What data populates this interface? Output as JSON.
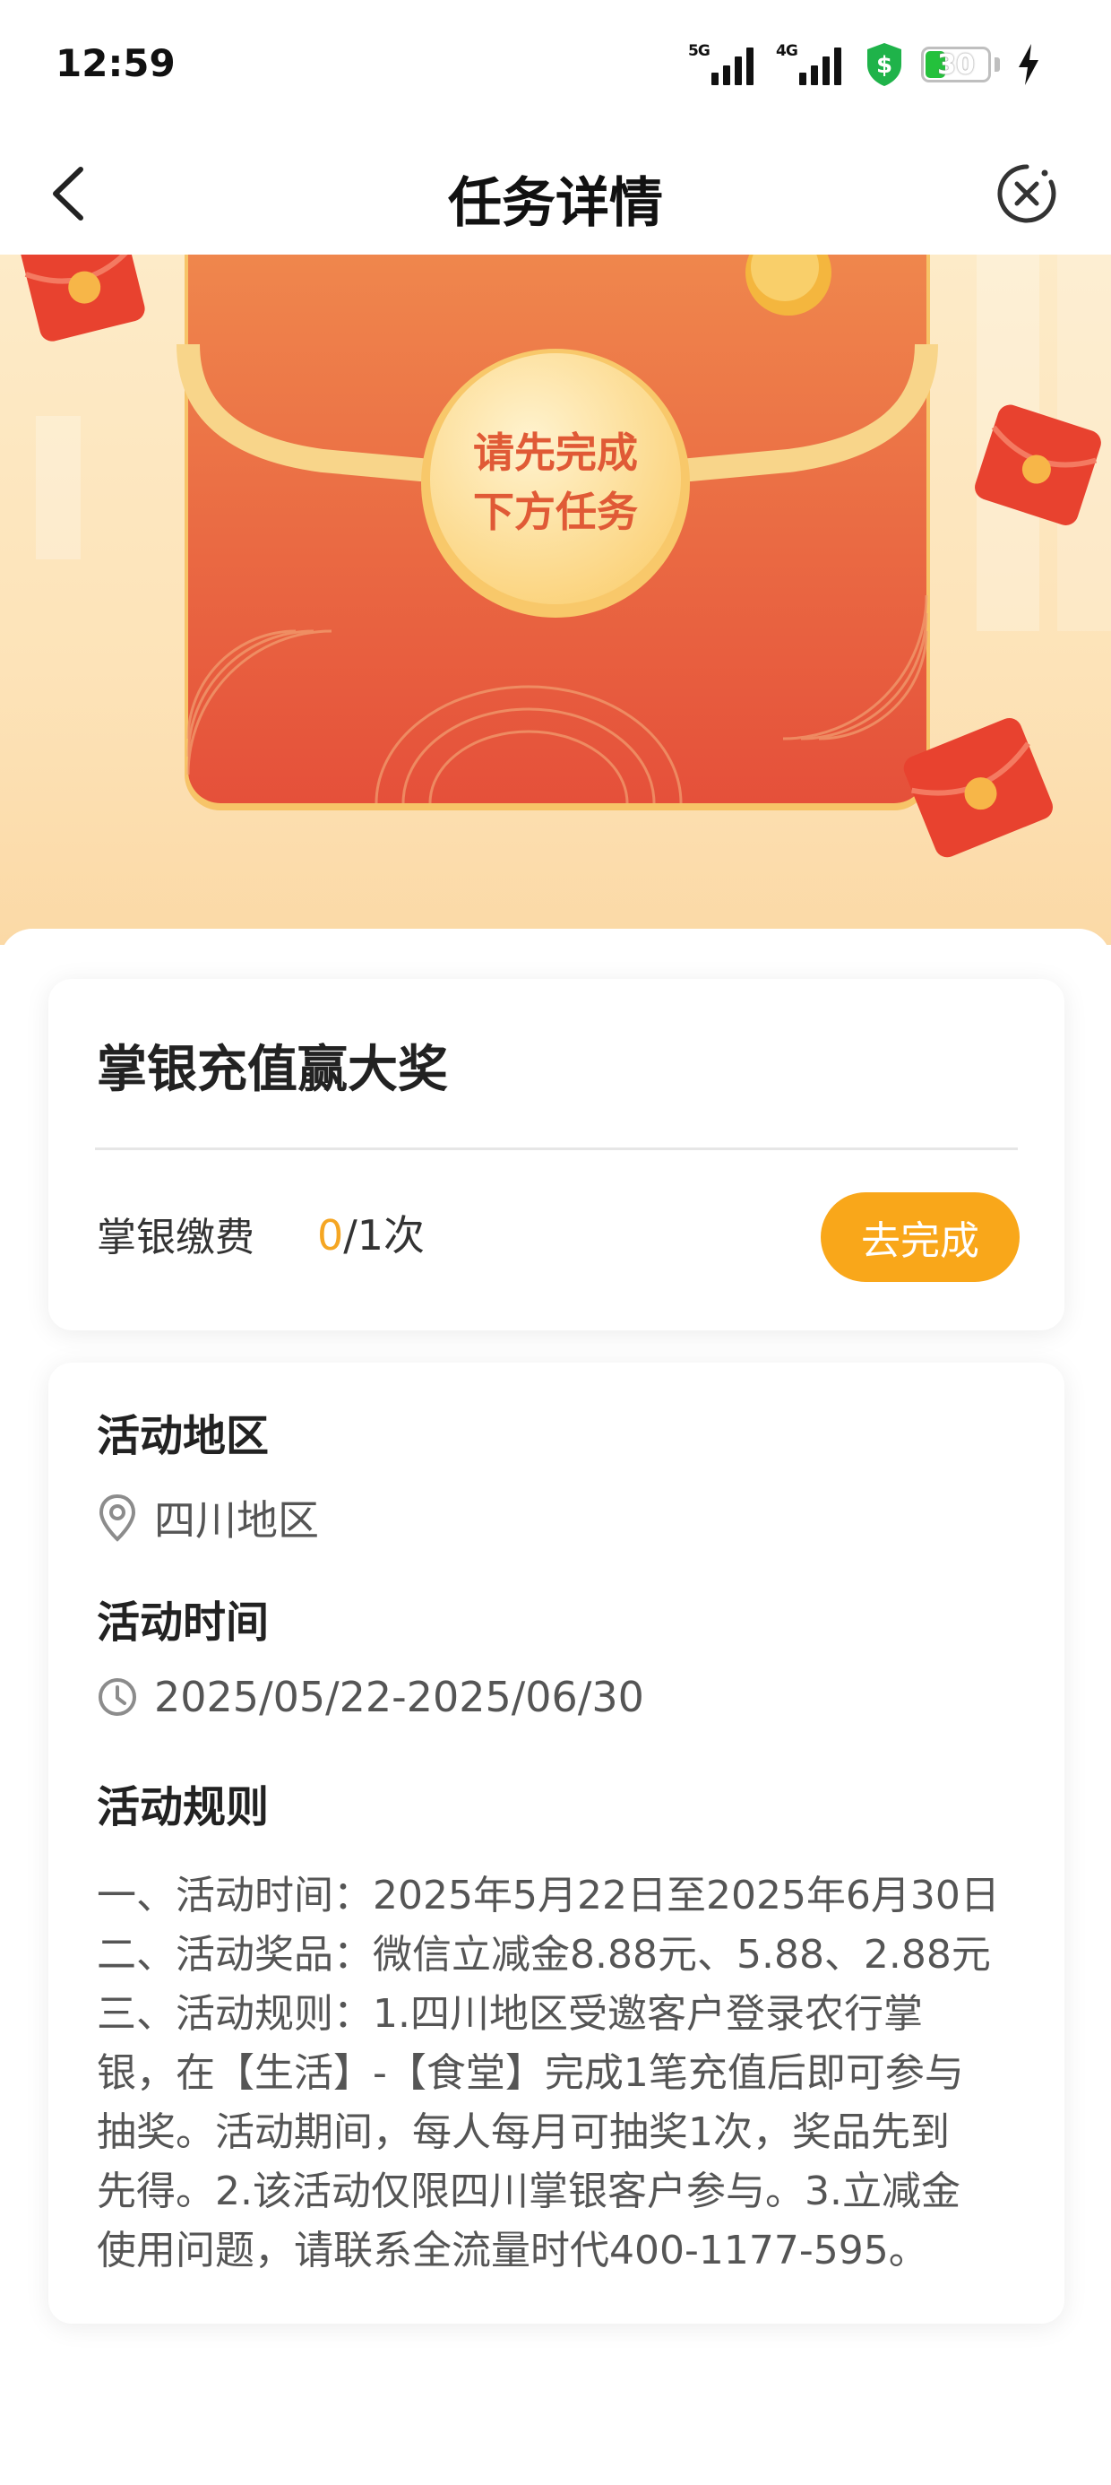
{
  "status_bar": {
    "time": "12:59",
    "signal_1": "5G",
    "signal_2": "4G",
    "battery": "30"
  },
  "nav": {
    "title": "任务详情"
  },
  "banner": {
    "coin_line1": "请先完成",
    "coin_line2": "下方任务"
  },
  "task_card": {
    "title": "掌银充值赢大奖",
    "task_label": "掌银缴费",
    "progress_done": "0",
    "progress_total": "/1次",
    "button_label": "去完成"
  },
  "info": {
    "region_heading": "活动地区",
    "region_value": "四川地区",
    "time_heading": "活动时间",
    "time_value": "2025/05/22-2025/06/30",
    "rules_heading": "活动规则",
    "rules_lines": [
      "一、活动时间：2025年5月22日至2025年6月30日",
      "二、活动奖品：微信立减金8.88元、5.88、2.88元",
      "三、活动规则：1.四川地区受邀客户登录农行掌",
      "银，在【生活】-【食堂】完成1笔充值后即可参与",
      "抽奖。活动期间，每人每月可抽奖1次，奖品先到",
      "先得。2.该活动仅限四川掌银客户参与。3.立减金",
      "使用问题，请联系全流量时代400-1177-595。"
    ]
  },
  "colors": {
    "accent": "#f9a71a",
    "progress_done": "#f5a623",
    "envelope": "#e8583a",
    "banner_bg": "#fde3b8"
  },
  "icons": [
    "back-arrow-icon",
    "close-circle-icon",
    "location-pin-icon",
    "clock-icon",
    "shield-dollar-icon",
    "bolt-icon"
  ]
}
